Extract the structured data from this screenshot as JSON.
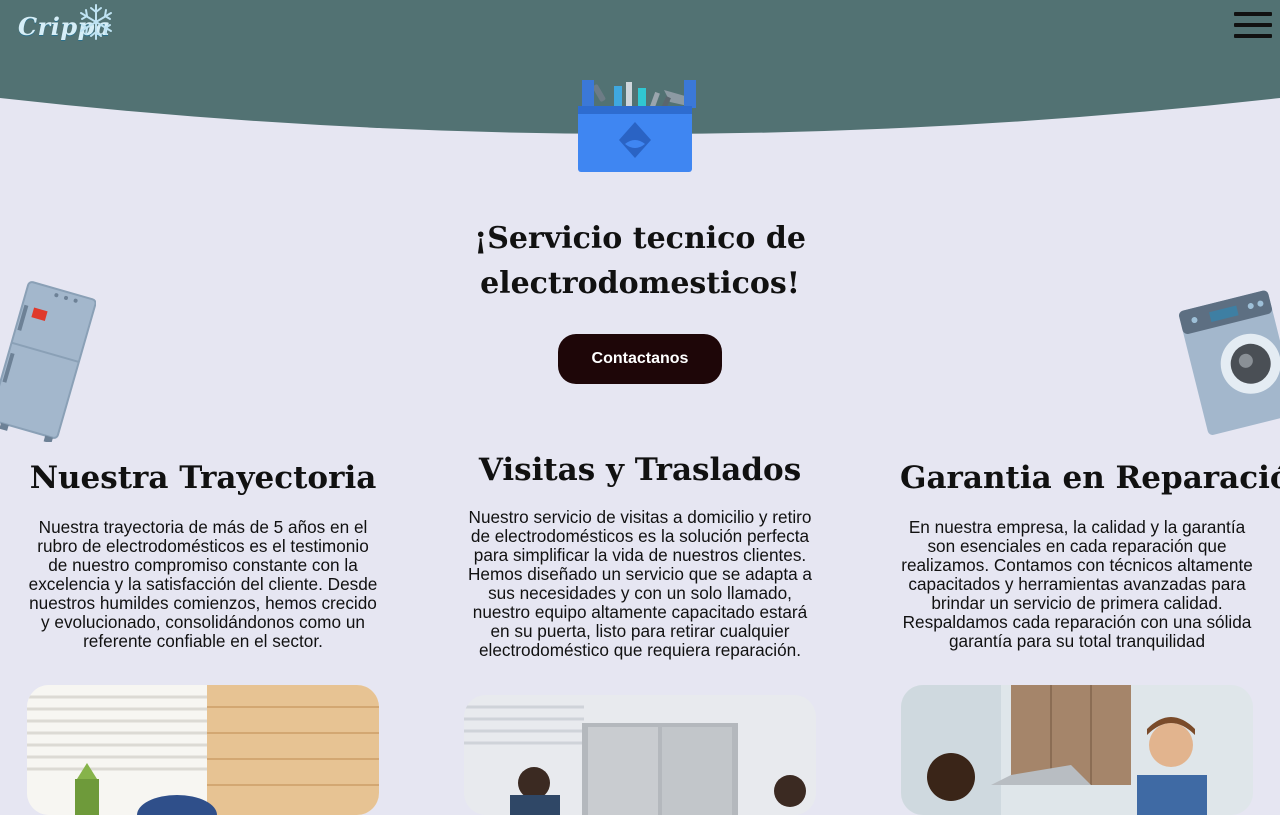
{
  "header": {
    "logo_text": "Crippa",
    "bg_color": "#527273"
  },
  "hero": {
    "title": "¡Servicio tecnico de electrodomesticos!",
    "cta_label": "Contactanos"
  },
  "features": [
    {
      "title": "Nuestra Trayectoria",
      "text": "Nuestra trayectoria de más de 5 años en el rubro de electrodomésticos es el testimonio de nuestro compromiso constante con la excelencia y la satisfacción del cliente. Desde nuestros humildes comienzos, hemos crecido y evolucionado, consolidándonos como un referente confiable en el sector."
    },
    {
      "title": "Visitas y Traslados",
      "text": "Nuestro servicio de visitas a domicilio y retiro de electrodomésticos es la solución perfecta para simplificar la vida de nuestros clientes. Hemos diseñado un servicio que se adapta a sus necesidades y con un solo llamado, nuestro equipo altamente capacitado estará en su puerta, listo para retirar cualquier electrodoméstico que requiera reparación."
    },
    {
      "title": "Garantia en Reparación",
      "text": "En nuestra empresa, la calidad y la garantía son esenciales en cada reparación que realizamos. Contamos con técnicos altamente capacitados y herramientas avanzadas para brindar un servicio de primera calidad. Respaldamos cada reparación con una sólida garantía para su total tranquilidad"
    }
  ],
  "colors": {
    "page_bg": "#e6e6f2",
    "button_bg": "#1e0608"
  },
  "icons": [
    "snowflake-icon",
    "hamburger-menu-icon",
    "toolbox-icon",
    "refrigerator-icon",
    "washing-machine-icon"
  ]
}
